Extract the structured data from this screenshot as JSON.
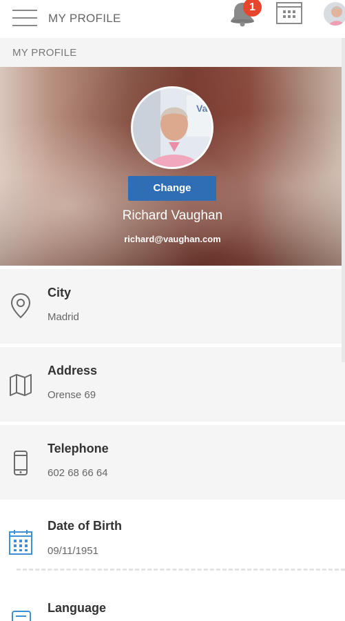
{
  "topbar": {
    "title": "MY PROFILE",
    "notification_count": "1"
  },
  "page_header": {
    "title": "MY PROFILE"
  },
  "profile": {
    "change_label": "Change",
    "name": "Richard Vaughan",
    "email": "richard@vaughan.com"
  },
  "fields": [
    {
      "label": "City",
      "value": "Madrid",
      "icon": "location-pin-icon"
    },
    {
      "label": "Address",
      "value": "Orense 69",
      "icon": "map-icon"
    },
    {
      "label": "Telephone",
      "value": "602 68 66 64",
      "icon": "phone-icon"
    },
    {
      "label": "Date of Birth",
      "value": "09/11/1951",
      "icon": "calendar-icon"
    },
    {
      "label": "Language",
      "value": "",
      "icon": "language-icon"
    }
  ],
  "colors": {
    "accent_blue": "#2f6db5",
    "badge_red": "#e8462c",
    "calendar_blue": "#3a8fd6"
  }
}
